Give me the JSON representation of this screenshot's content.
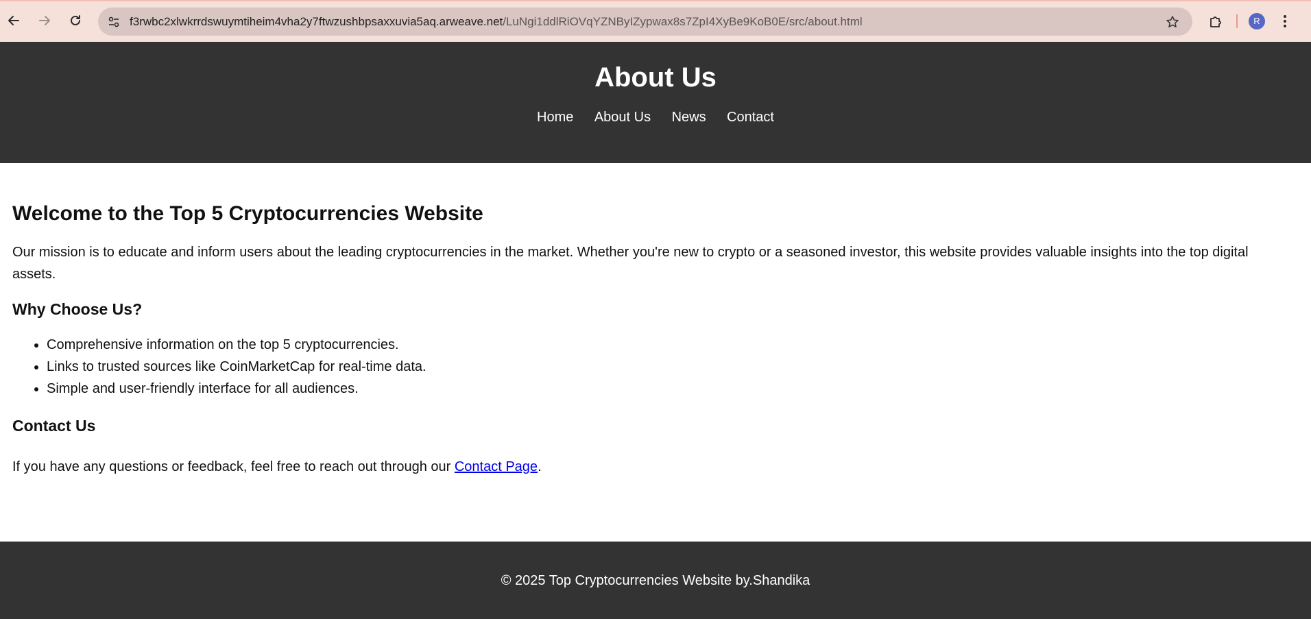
{
  "browser": {
    "url_host": "f3rwbc2xlwkrrdswuymtiheim4vha2y7ftwzushbpsaxxuvia5aq.arweave.net",
    "url_path": "/LuNgi1ddlRiOVqYZNByIZypwax8s7ZpI4XyBe9KoB0E/src/about.html",
    "profile_initial": "R",
    "icons": {
      "back": "back-arrow-icon",
      "forward": "forward-arrow-icon",
      "reload": "reload-icon",
      "site_info": "tune-icon",
      "bookmark": "star-icon",
      "extensions": "puzzle-icon",
      "menu": "kebab-menu-icon"
    }
  },
  "header": {
    "title": "About Us",
    "nav": [
      "Home",
      "About Us",
      "News",
      "Contact"
    ]
  },
  "main": {
    "heading": "Welcome to the Top 5 Cryptocurrencies Website",
    "mission": "Our mission is to educate and inform users about the leading cryptocurrencies in the market. Whether you're new to crypto or a seasoned investor, this website provides valuable insights into the top digital assets.",
    "why_heading": "Why Choose Us?",
    "why_items": [
      "Comprehensive information on the top 5 cryptocurrencies.",
      "Links to trusted sources like CoinMarketCap for real-time data.",
      "Simple and user-friendly interface for all audiences."
    ],
    "contact_heading": "Contact Us",
    "contact_text_before": "If you have any questions or feedback, feel free to reach out through our ",
    "contact_link": "Contact Page",
    "contact_text_after": "."
  },
  "footer": {
    "text": "© 2025 Top Cryptocurrencies Website by.Shandika"
  },
  "colors": {
    "chrome_bg": "#f6e0da",
    "omnibox_bg": "#d9c6c2",
    "header_bg": "#333333",
    "link": "#0000ee",
    "avatar": "#5667c5"
  }
}
